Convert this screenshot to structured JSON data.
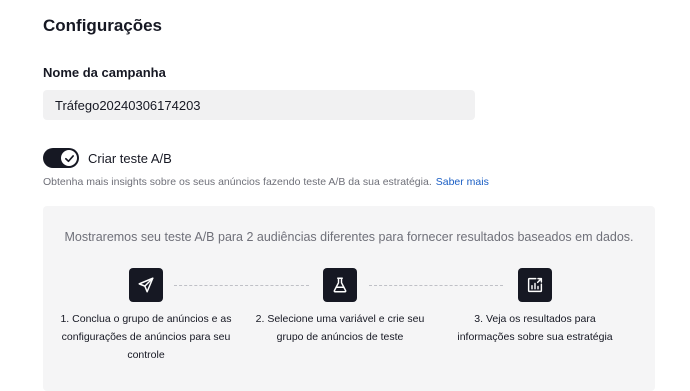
{
  "settings": {
    "title": "Configurações",
    "campaign_name_label": "Nome da campanha",
    "campaign_name_value": "Tráfego20240306174203"
  },
  "ab_test": {
    "toggle_label": "Criar teste A/B",
    "toggle_on": true,
    "helper_text": "Obtenha mais insights sobre os seus anúncios fazendo teste A/B da sua estratégia.",
    "learn_more": "Saber mais"
  },
  "info": {
    "description": "Mostraremos seu teste A/B para 2 audiências diferentes para fornecer resultados baseados em dados.",
    "steps": [
      {
        "icon": "send-icon",
        "text": "1. Conclua o grupo de anúncios e as configurações de anúncios para seu controle"
      },
      {
        "icon": "flask-icon",
        "text": "2. Selecione uma variável e crie seu grupo de anúncios de teste"
      },
      {
        "icon": "report-chart-icon",
        "text": "3. Veja os resultados para informações sobre sua estratégia"
      }
    ]
  },
  "colors": {
    "dark": "#161823",
    "link": "#1a5ec4",
    "muted_text": "#6f7079",
    "input_bg": "#f1f1f2",
    "panel_bg": "#f5f5f6"
  }
}
